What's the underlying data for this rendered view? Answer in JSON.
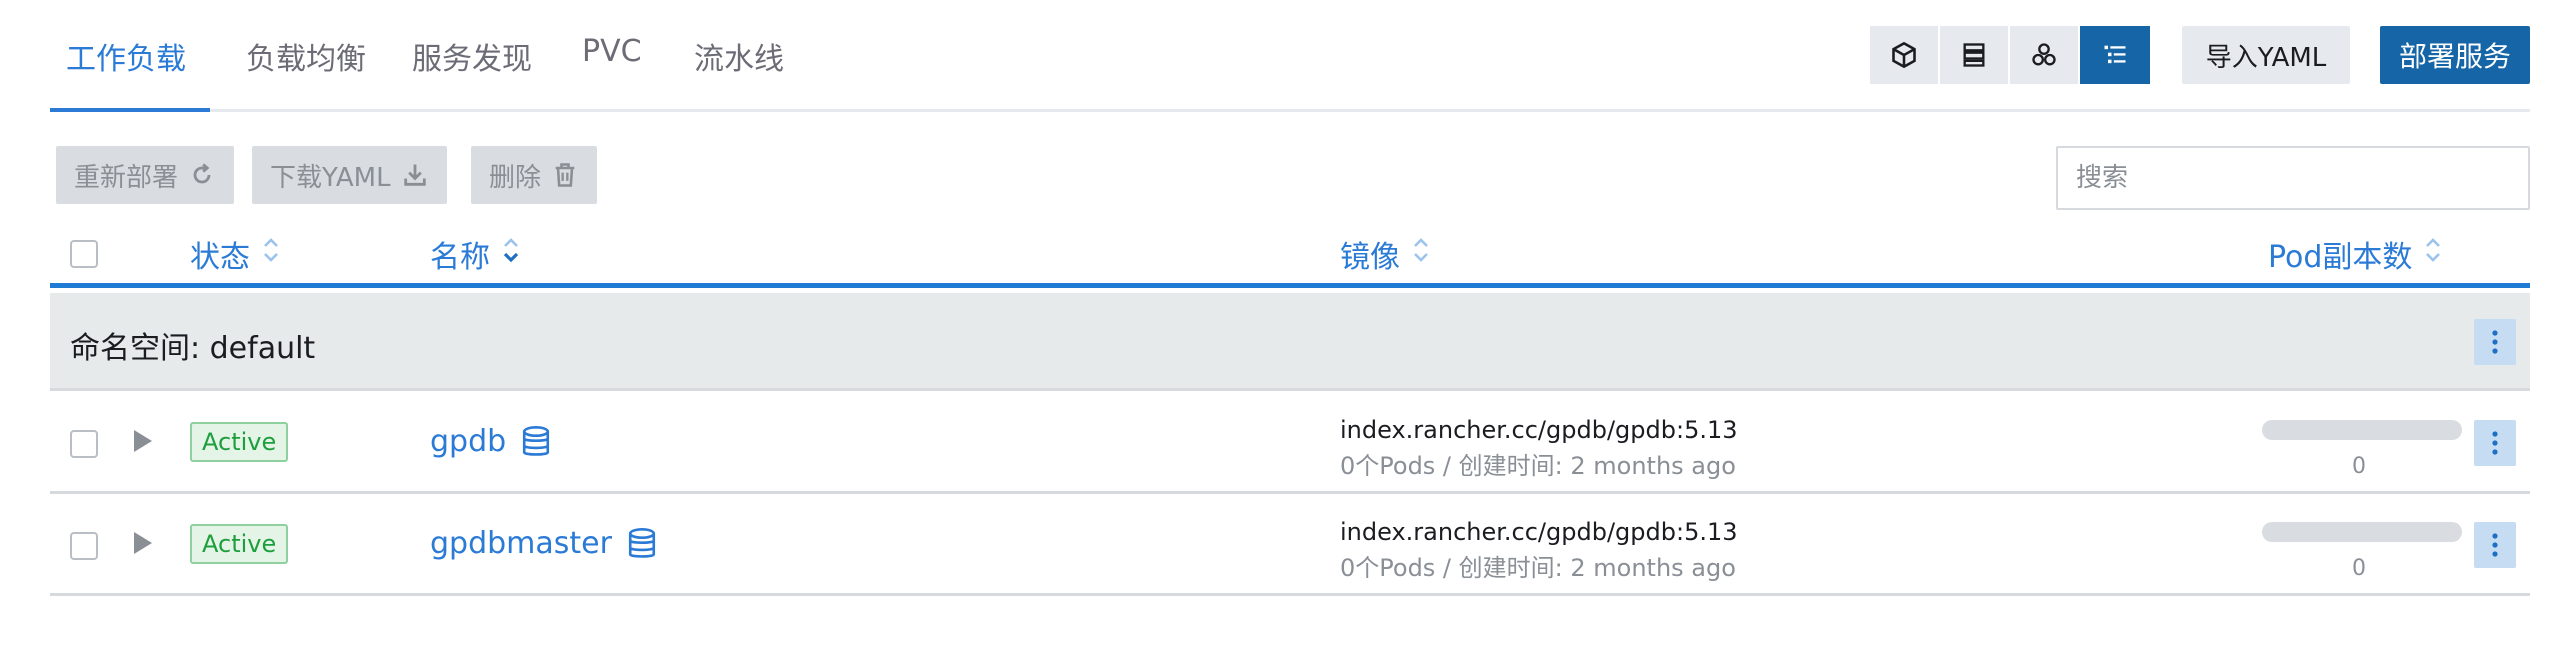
{
  "tabs": [
    {
      "label": "工作负载",
      "active": true
    },
    {
      "label": "负载均衡",
      "active": false
    },
    {
      "label": "服务发现",
      "active": false
    },
    {
      "label": "PVC",
      "active": false
    },
    {
      "label": "流水线",
      "active": false
    }
  ],
  "view_toggles": [
    {
      "icon": "cube-icon",
      "active": false
    },
    {
      "icon": "server-stack-icon",
      "active": false
    },
    {
      "icon": "cluster-nodes-icon",
      "active": false
    },
    {
      "icon": "list-tree-icon",
      "active": true
    }
  ],
  "actions": {
    "import_label": "导入YAML",
    "deploy_label": "部署服务"
  },
  "bulk_actions": {
    "redeploy_label": "重新部署",
    "download_label": "下载YAML",
    "delete_label": "删除"
  },
  "search": {
    "placeholder": "搜索",
    "value": ""
  },
  "table": {
    "columns": {
      "state": "状态",
      "name": "名称",
      "image": "镜像",
      "pods": "Pod副本数"
    },
    "group": {
      "label": "命名空间: default"
    },
    "rows": [
      {
        "state": "Active",
        "name": "gpdb",
        "image": "index.rancher.cc/gpdb/gpdb:5.13",
        "sub": "0个Pods / 创建时间: 2 months ago",
        "pod_fill": 0,
        "pod_count": "0"
      },
      {
        "state": "Active",
        "name": "gpdbmaster",
        "image": "index.rancher.cc/gpdb/gpdb:5.13",
        "sub": "0个Pods / 创建时间: 2 months ago",
        "pod_fill": 0,
        "pod_count": "0"
      }
    ]
  },
  "colors": {
    "accent": "#2b7bd6",
    "primary_button": "#1565a7",
    "active_badge": "#1e9e3c"
  }
}
